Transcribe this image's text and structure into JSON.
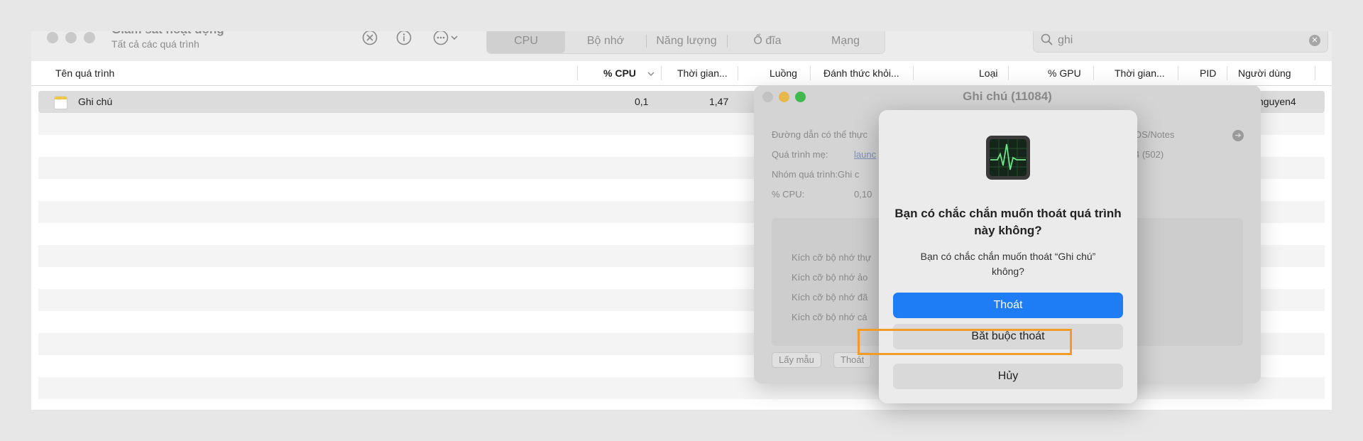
{
  "app": {
    "title": "Giám sát hoạt động",
    "subtitle": "Tất cả các quá trình"
  },
  "toolbar": {
    "stop_icon": "x-circle-icon",
    "info_icon": "info-circle-icon",
    "more_icon": "ellipsis-circle-icon",
    "tabs": [
      {
        "label": "CPU",
        "selected": true
      },
      {
        "label": "Bộ nhớ",
        "selected": false
      },
      {
        "label": "Năng lượng",
        "selected": false
      },
      {
        "label": "Ổ đĩa",
        "selected": false
      },
      {
        "label": "Mạng",
        "selected": false
      }
    ],
    "search_value": "ghi"
  },
  "table": {
    "columns": [
      "Tên quá trình",
      "% CPU",
      "Thời gian...",
      "Luồng",
      "Đánh thức khỏi...",
      "Loại",
      "% GPU",
      "Thời gian...",
      "PID",
      "Người dùng"
    ],
    "rows": [
      {
        "name": "Ghi chú",
        "cpu": "0,1",
        "time": "1,47",
        "user": "nguyen4"
      }
    ]
  },
  "info_window": {
    "title": "Ghi chú (11084)",
    "path_label": "Đường dẫn có thể thực",
    "path_value": "OS/Notes",
    "parent_label": "Quá trình mẹ:",
    "parent_value": "launc",
    "parent_pid": "4 (502)",
    "group_label": "Nhóm quá trình:",
    "group_value": "Ghi c",
    "cpu_label": "% CPU:",
    "cpu_value": "0,10",
    "mem_lines": [
      "Kích cỡ bộ nhớ thự",
      "Kích cỡ bộ nhớ ảo",
      "Kích cỡ bộ nhớ đã",
      "Kích cỡ bộ nhớ cá"
    ],
    "sample_button": "Lấy mẫu",
    "quit_button": "Thoát"
  },
  "dialog": {
    "heading": "Bạn có chắc chắn muốn thoát quá trình này không?",
    "message": "Bạn có chắc chắn muốn thoát “Ghi chú” không?",
    "quit_button": "Thoát",
    "force_quit_button": "Bắt buộc thoát",
    "cancel_button": "Hủy",
    "highlight_color": "#f29b26",
    "accent_color": "#1e7cf5"
  }
}
